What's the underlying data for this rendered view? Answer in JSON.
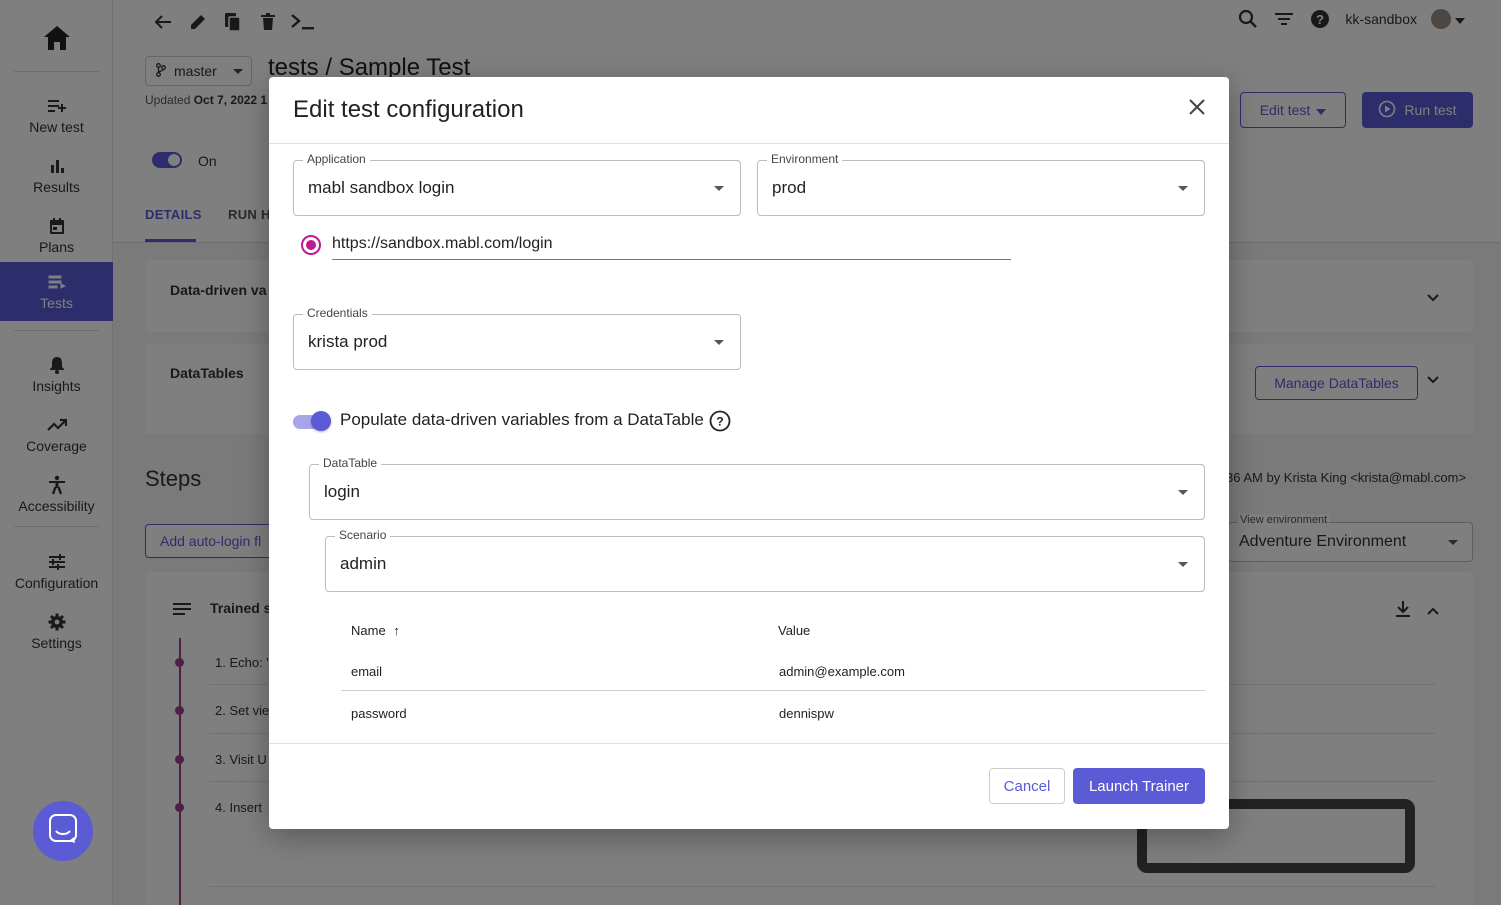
{
  "sidebar": {
    "home_icon": "home-icon",
    "items": [
      {
        "label": "New test",
        "icon": "playlist-add-icon"
      },
      {
        "label": "Results",
        "icon": "bar-chart-icon"
      },
      {
        "label": "Plans",
        "icon": "calendar-icon"
      },
      {
        "label": "Tests",
        "icon": "list-icon",
        "active": true
      },
      {
        "label": "Insights",
        "icon": "bell-icon"
      },
      {
        "label": "Coverage",
        "icon": "trending-up-icon"
      },
      {
        "label": "Accessibility",
        "icon": "accessibility-icon"
      },
      {
        "label": "Configuration",
        "icon": "tune-icon"
      },
      {
        "label": "Settings",
        "icon": "gear-icon"
      }
    ]
  },
  "toolbar": {
    "icons": [
      "back-arrow-icon",
      "pencil-icon",
      "copy-icon",
      "trash-icon",
      "terminal-icon"
    ],
    "right_icons": [
      "search-icon",
      "filter-icon",
      "help-icon"
    ],
    "workspace": "kk-sandbox"
  },
  "page": {
    "branch": "master",
    "title": "tests / Sample Test",
    "updated_prefix": "Updated",
    "updated_date": "Oct 7, 2022 1",
    "toggle_label": "On",
    "tabs": [
      "DETAILS",
      "RUN H"
    ],
    "edit_test_label": "Edit test",
    "run_test_label": "Run test",
    "data_driven_label": "Data-driven va",
    "datatables_label": "DataTables",
    "manage_datatables_label": "Manage DataTables",
    "steps_title": "Steps",
    "auto_login_label": "Add auto-login fl",
    "modified_text": "36 AM by Krista King <krista@mabl.com>",
    "view_env_label": "View environment",
    "view_env_value": "Adventure Environment",
    "trained_label": "Trained s",
    "steps": [
      "1. Echo: \"",
      "2. Set vie",
      "3. Visit U",
      "4. Insert"
    ]
  },
  "modal": {
    "title": "Edit test configuration",
    "application": {
      "label": "Application",
      "value": "mabl sandbox login"
    },
    "environment": {
      "label": "Environment",
      "value": "prod"
    },
    "url": "https://sandbox.mabl.com/login",
    "credentials": {
      "label": "Credentials",
      "value": "krista prod"
    },
    "populate_label": "Populate data-driven variables from a DataTable",
    "datatable": {
      "label": "DataTable",
      "value": "login"
    },
    "scenario": {
      "label": "Scenario",
      "value": "admin"
    },
    "table": {
      "headers": [
        "Name",
        "Value"
      ],
      "sort_indicator": "↑",
      "rows": [
        {
          "name": "email",
          "value": "admin@example.com"
        },
        {
          "name": "password",
          "value": "dennispw"
        }
      ]
    },
    "cancel_label": "Cancel",
    "launch_label": "Launch Trainer"
  },
  "colors": {
    "accent": "#5b5bd6",
    "radio": "#c0188f",
    "timeline": "#a23c8c"
  }
}
